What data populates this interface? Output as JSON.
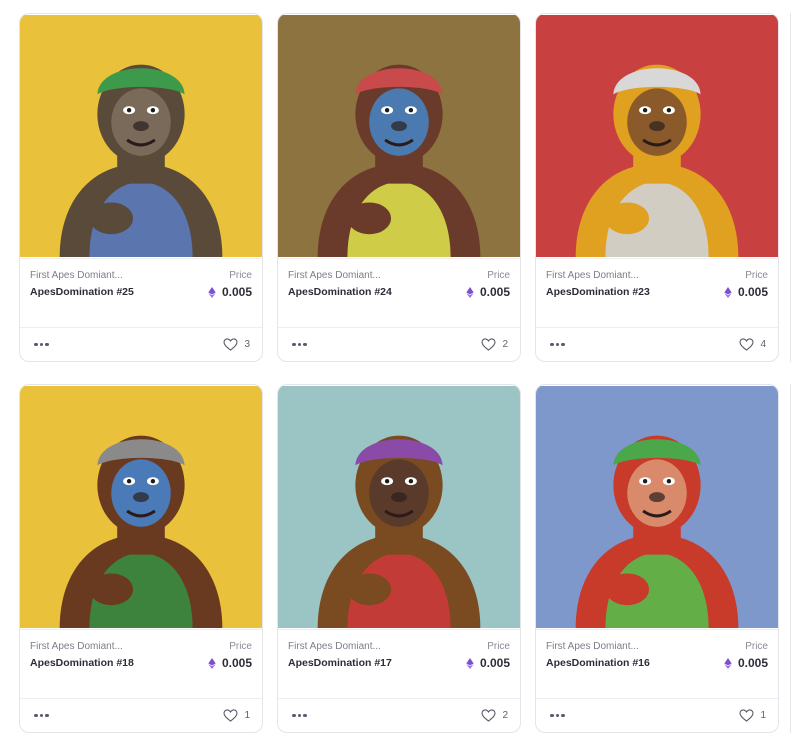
{
  "cards": [
    {
      "collection": "First Apes Domiant...",
      "name": "ApesDomination #25",
      "price_label": "Price",
      "price": "0.005",
      "likes": "3",
      "bg": "#E9C13A",
      "fur": "#5a4a3a",
      "face": "#7a6a5a",
      "accent": "#5b78b8",
      "hat": "#3d9a4a"
    },
    {
      "collection": "First Apes Domiant...",
      "name": "ApesDomination #24",
      "price_label": "Price",
      "price": "0.005",
      "likes": "2",
      "bg": "#8C7340",
      "fur": "#6a3a2a",
      "face": "#4a7ab0",
      "accent": "#d8d94a",
      "hat": "#c84a4a"
    },
    {
      "collection": "First Apes Domiant...",
      "name": "ApesDomination #23",
      "price_label": "Price",
      "price": "0.005",
      "likes": "4",
      "bg": "#C94040",
      "fur": "#e0a020",
      "face": "#8a5a2a",
      "accent": "#d0d0d0",
      "hat": "#d8d8d8"
    },
    {
      "collection": "First Apes Domiant...",
      "name": "ApesDomination #18",
      "price_label": "Price",
      "price": "0.005",
      "likes": "1",
      "bg": "#E9C13A",
      "fur": "#6a3a20",
      "face": "#4a7ab8",
      "accent": "#3a8a40",
      "hat": "#8a8a8a"
    },
    {
      "collection": "First Apes Domiant...",
      "name": "ApesDomination #17",
      "price_label": "Price",
      "price": "0.005",
      "likes": "2",
      "bg": "#9AC5C4",
      "fur": "#7a4a20",
      "face": "#5a3a2a",
      "accent": "#c83a3a",
      "hat": "#8a4aa8"
    },
    {
      "collection": "First Apes Domiant...",
      "name": "ApesDomination #16",
      "price_label": "Price",
      "price": "0.005",
      "likes": "1",
      "bg": "#7F98CB",
      "fur": "#c83a2a",
      "face": "#d88a6a",
      "accent": "#5ab84a",
      "hat": "#4aa84a"
    }
  ],
  "icons": {
    "currency": "ethereum-icon",
    "more": "more-dots-icon",
    "like": "heart-icon"
  }
}
